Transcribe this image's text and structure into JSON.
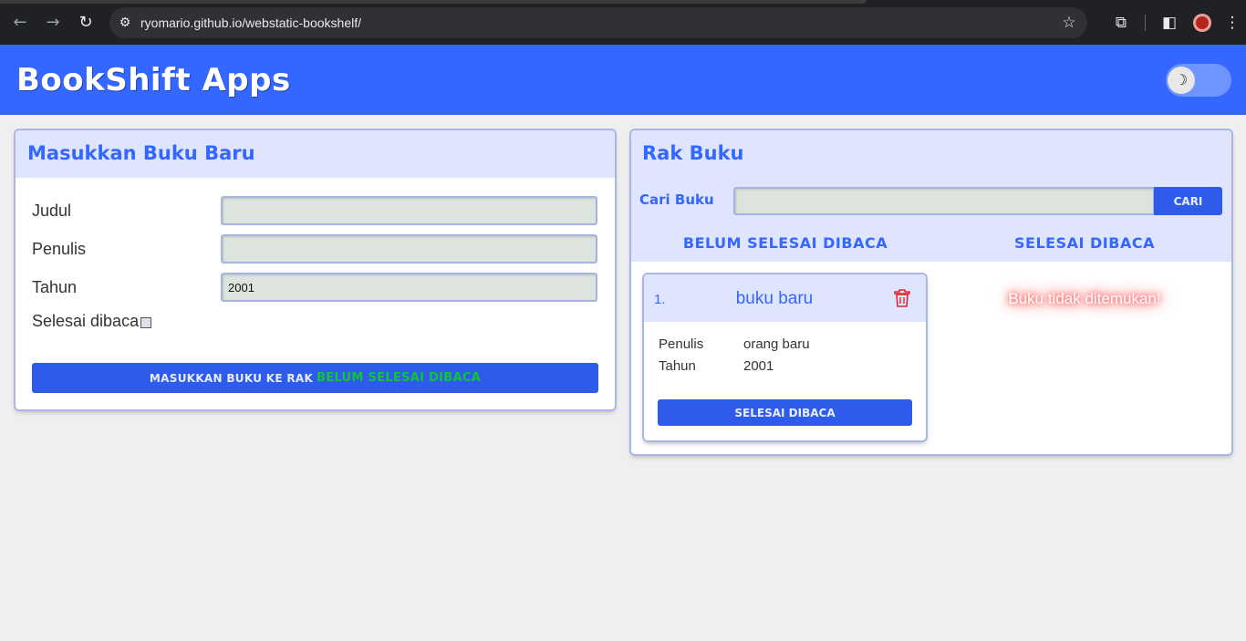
{
  "browser": {
    "url": "ryomario.github.io/webstatic-bookshelf/",
    "icons": [
      "back-icon",
      "forward-icon",
      "reload-icon",
      "site-settings-icon",
      "star-icon",
      "extensions-icon",
      "sidebar-icon",
      "profile-icon",
      "menu-icon"
    ]
  },
  "header": {
    "title": "BookShift Apps",
    "theme_toggle_icon": "☽"
  },
  "form": {
    "title": "Masukkan Buku Baru",
    "judul_label": "Judul",
    "judul_value": "",
    "penulis_label": "Penulis",
    "penulis_value": "",
    "tahun_label": "Tahun",
    "tahun_value": "2001",
    "selesai_label": "Selesai dibaca",
    "selesai_checked": false,
    "submit_prefix": "MASUKKAN BUKU KE RAK",
    "submit_target": "BELUM SELESAI DIBACA"
  },
  "shelf": {
    "title": "Rak Buku",
    "search_label": "Cari Buku",
    "search_value": "",
    "search_button": "CARI",
    "col_unread": "BELUM SELESAI DIBACA",
    "col_read": "SELESAI DIBACA",
    "unread_books": [
      {
        "number": "1.",
        "title": "buku baru",
        "author_label": "Penulis",
        "author": "orang baru",
        "year_label": "Tahun",
        "year": "2001",
        "action": "SELESAI DIBACA"
      }
    ],
    "read_empty_message": "Buku tidak ditemukan!"
  },
  "colors": {
    "primary": "#3367ff",
    "button": "#2f5bea",
    "panel_head": "#dfe5ff",
    "highlight_green": "#11c43a",
    "danger": "#e0242a"
  }
}
